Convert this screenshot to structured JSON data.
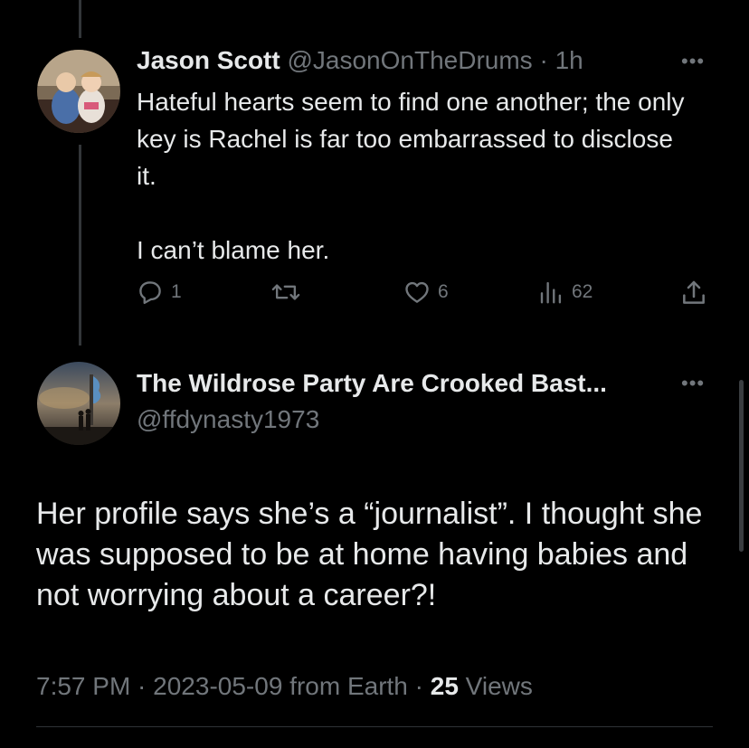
{
  "reply": {
    "author_name": "Jason Scott",
    "author_handle": "@JasonOnTheDrums",
    "separator": "·",
    "time": "1h",
    "paragraphs": [
      "Hateful hearts seem to find one another; the only key is Rachel is far too embarrassed to disclose it.",
      "I can’t blame her."
    ],
    "actions": {
      "replies": "1",
      "retweets": "",
      "likes": "6",
      "views": "62"
    },
    "more": "•••"
  },
  "main_tweet": {
    "author_name": "The Wildrose Party Are Crooked Bast...",
    "author_handle": "@ffdynasty1973",
    "more": "•••",
    "text": "Her profile says she’s a “journalist”.  I thought she was supposed to be at home having babies and not worrying about a career?!",
    "timestamp": "7:57 PM · 2023-05-09 from Earth · ",
    "views_count": "25",
    "views_label": " Views"
  },
  "icons": [
    "reply-icon",
    "retweet-icon",
    "like-icon",
    "views-icon",
    "share-icon",
    "more-icon"
  ],
  "colors": {
    "background": "#000000",
    "primary_text": "#e7e9ea",
    "secondary_text": "#71767b",
    "divider": "#2f3336"
  }
}
